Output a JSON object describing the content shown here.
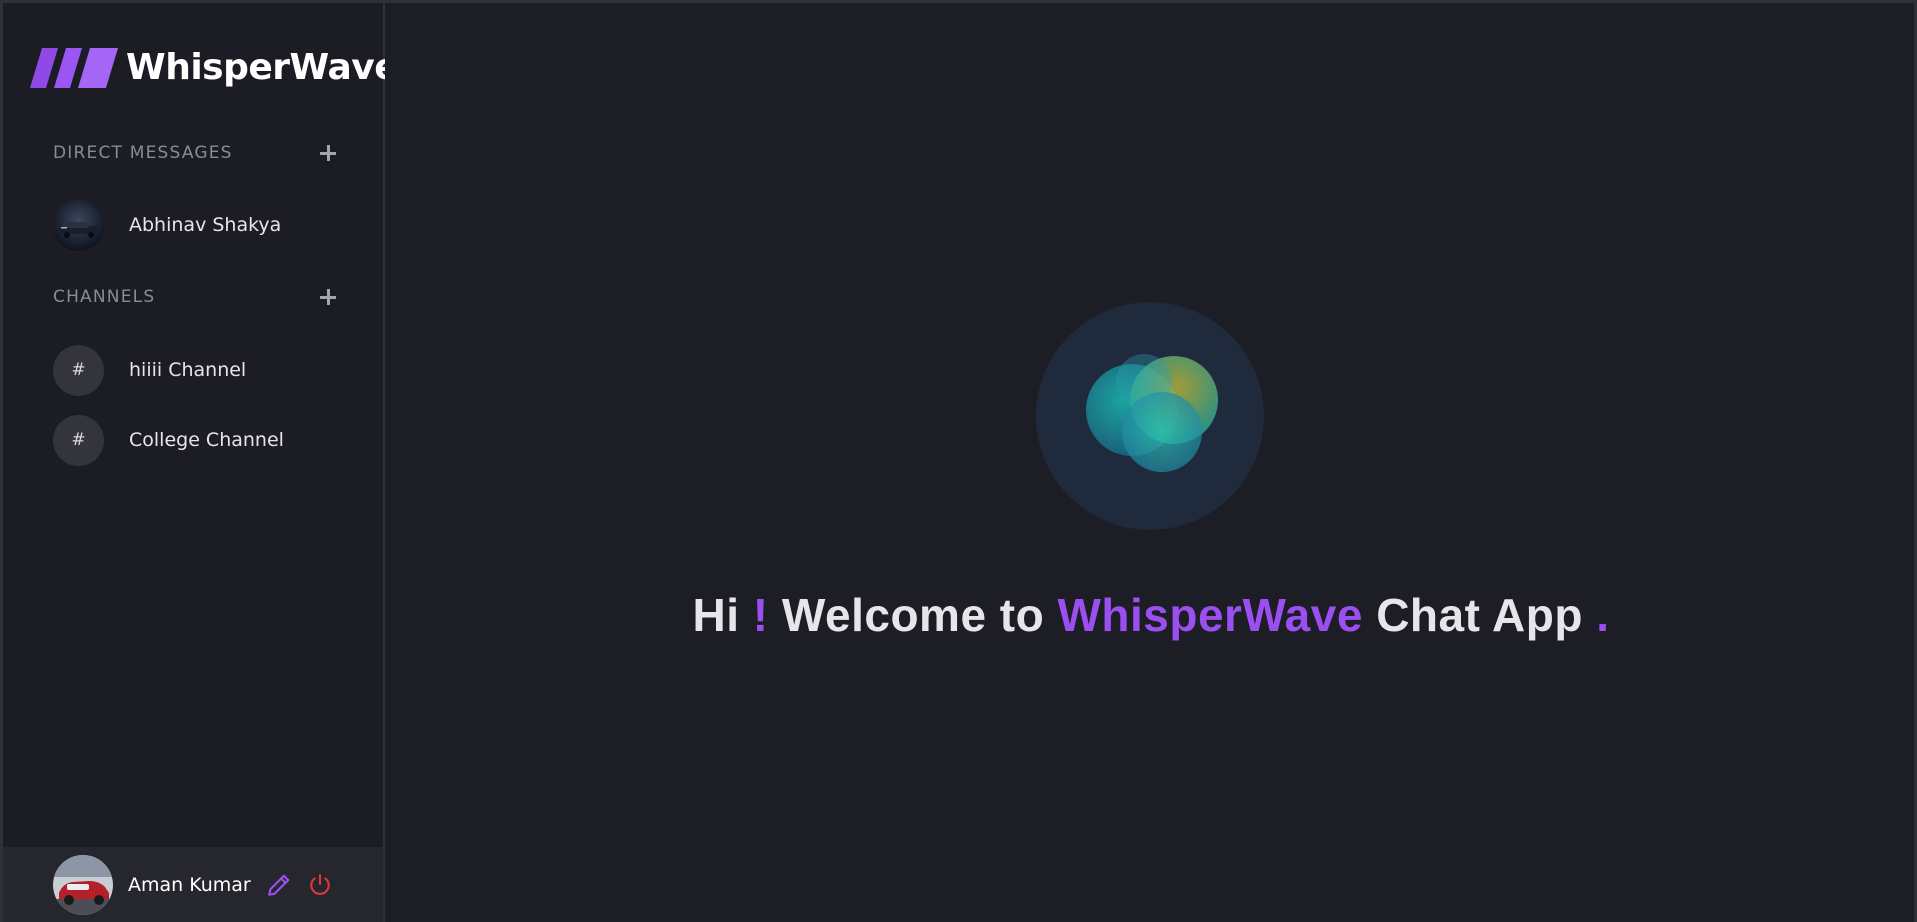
{
  "app": {
    "name": "WhisperWave",
    "accent_color": "#9b4ff0"
  },
  "sidebar": {
    "direct_messages": {
      "title": "DIRECT MESSAGES",
      "items": [
        {
          "label": "Abhinav Shakya",
          "icon": "user-avatar"
        }
      ]
    },
    "channels": {
      "title": "CHANNELS",
      "items": [
        {
          "label": "hiiii Channel",
          "icon": "#"
        },
        {
          "label": "College Channel",
          "icon": "#"
        }
      ]
    }
  },
  "profile": {
    "name": "Aman Kumar",
    "edit_icon": "pencil-icon",
    "logout_icon": "power-icon"
  },
  "welcome": {
    "hi": "Hi",
    "bang": "!",
    "welcome_to": "Welcome to",
    "brand": "WhisperWave",
    "suffix": "Chat App",
    "dot": "."
  }
}
